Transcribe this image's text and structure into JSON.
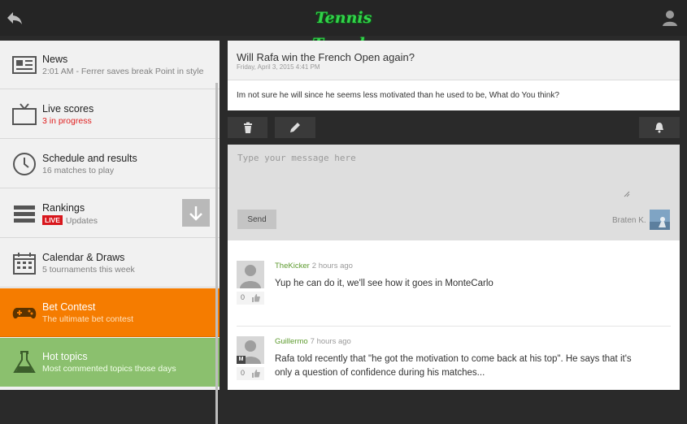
{
  "app": {
    "logo_text": "Tennis Temple",
    "accent_green": "#32d24a",
    "orange": "#f57c00",
    "light_green": "#8bc06e"
  },
  "sidebar": {
    "items": [
      {
        "title": "News",
        "subtitle": "2:01 AM - Ferrer saves break Point in style",
        "icon": "newspaper-icon"
      },
      {
        "title": "Live scores",
        "subtitle": "3 in progress",
        "icon": "tv-icon"
      },
      {
        "title": "Schedule and results",
        "subtitle": "16 matches to play",
        "icon": "clock-icon"
      },
      {
        "title": "Rankings",
        "badge": "LIVE",
        "subtitle": "Updates",
        "icon": "list-icon"
      },
      {
        "title": "Calendar & Draws",
        "subtitle": "5 tournaments this week",
        "icon": "calendar-icon"
      },
      {
        "title": "Bet Contest",
        "subtitle": "The ultimate bet contest",
        "icon": "gamepad-icon"
      },
      {
        "title": "Hot topics",
        "subtitle": "Most commented topics those days",
        "icon": "flask-icon"
      }
    ]
  },
  "post": {
    "title": "Will Rafa win the French Open again?",
    "date": "Friday, April 3, 2015 4:41 PM",
    "body": "Im not sure he will since he seems less motivated than he used to be, What do You think?"
  },
  "toolbar": {
    "delete_icon": "trash-icon",
    "edit_icon": "pencil-icon",
    "notify_icon": "bell-icon"
  },
  "compose": {
    "placeholder": "Type your message here",
    "send_label": "Send",
    "author": "Braten K."
  },
  "comments": [
    {
      "user": "TheKicker",
      "time": "2 hours ago",
      "text": "Yup he can do it, we'll see how it goes in MonteCarlo",
      "votes": "0",
      "badge": ""
    },
    {
      "user": "Guillermo",
      "time": "7 hours ago",
      "text": "Rafa told recently that \"he got the motivation to come back at his top\". He says that it's only a question of confidence during his matches...",
      "votes": "0",
      "badge": "M"
    }
  ]
}
